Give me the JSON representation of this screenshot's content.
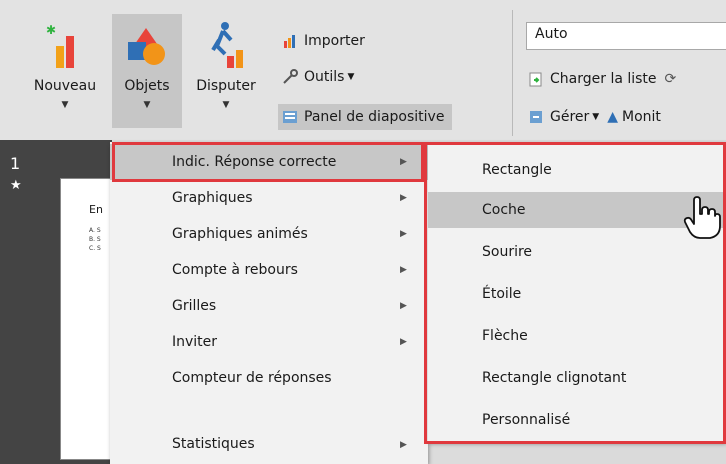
{
  "ribbon": {
    "nouveau_label": "Nouveau",
    "objets_label": "Objets",
    "disputer_label": "Disputer",
    "importer_label": "Importer",
    "outils_label": "Outils",
    "panel_label": "Panel de diapositive",
    "auto_value": "Auto",
    "charger_label": "Charger la liste",
    "gerer_label": "Gérer",
    "monit_label": "Monit"
  },
  "slide_pane": {
    "number": "1",
    "star": "★",
    "thumb_title": "En",
    "thumb_a": "A. S",
    "thumb_b": "B. S",
    "thumb_c": "C. S"
  },
  "menu": {
    "items": [
      {
        "label": "Indic. Réponse correcte"
      },
      {
        "label": "Graphiques"
      },
      {
        "label": "Graphiques animés"
      },
      {
        "label": "Compte à rebours"
      },
      {
        "label": "Grilles"
      },
      {
        "label": "Inviter"
      },
      {
        "label": "Compteur de réponses"
      },
      {
        "label": "Statistiques"
      }
    ]
  },
  "submenu": {
    "items": [
      {
        "label": "Rectangle"
      },
      {
        "label": "Coche"
      },
      {
        "label": "Sourire"
      },
      {
        "label": "Étoile"
      },
      {
        "label": "Flèche"
      },
      {
        "label": "Rectangle clignotant"
      },
      {
        "label": "Personnalisé"
      }
    ]
  },
  "colors": {
    "highlight": "#e0393e",
    "menu_hover": "#c7c7c7"
  }
}
